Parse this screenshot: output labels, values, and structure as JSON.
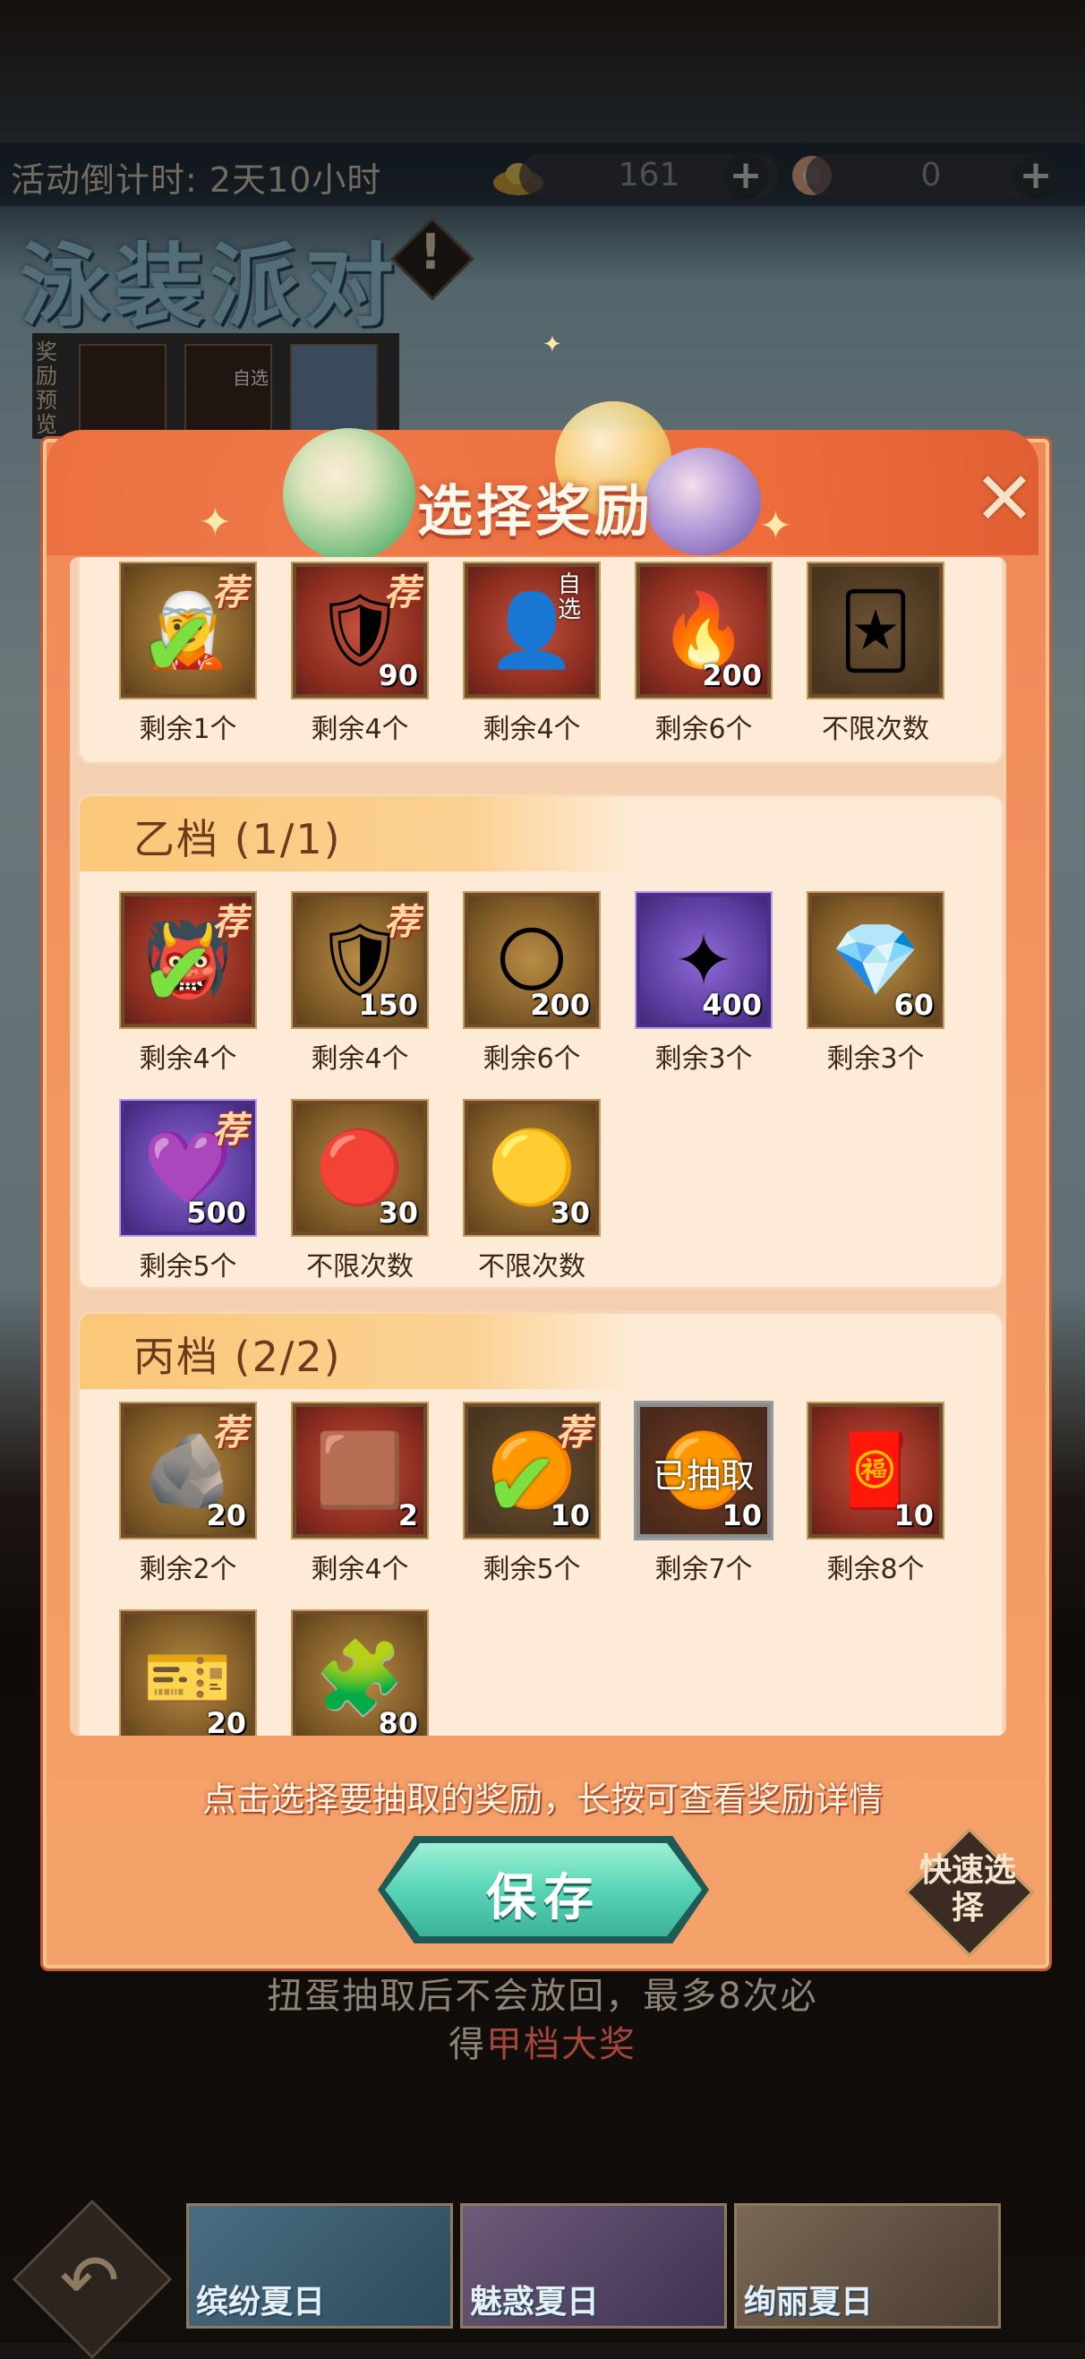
{
  "header": {
    "countdown": "活动倒计时: 2天10小时",
    "gold_amount": "161",
    "pearl_amount": "0",
    "plus_symbol": "+",
    "event_title": "泳装派对",
    "info_symbol": "!",
    "preview_label": "奖励预览",
    "preview_choose_tag": "自选"
  },
  "modal": {
    "title": "选择奖励",
    "close_symbol": "✕",
    "hint": "点击选择要抽取的奖励，长按可查看奖励详情",
    "save_label": "保存",
    "quick_label": "快速选择"
  },
  "tier_a": {
    "items": [
      {
        "icon": "character-card-icon",
        "glyph": "🧝",
        "style": "gold",
        "recommended": true,
        "checked": true,
        "quantity": "",
        "remaining": "剩余1个"
      },
      {
        "icon": "divine-banner-icon",
        "glyph": "🛡",
        "style": "red",
        "recommended": true,
        "checked": false,
        "quantity": "90",
        "remaining": "剩余4个"
      },
      {
        "icon": "silhouette-select-icon",
        "glyph": "👤",
        "style": "red",
        "recommended": false,
        "checked": false,
        "quantity": "",
        "choose": "自选",
        "remaining": "剩余4个"
      },
      {
        "icon": "fire-orb-icon",
        "glyph": "🔥",
        "style": "red",
        "recommended": false,
        "checked": false,
        "quantity": "200",
        "remaining": "剩余6个"
      },
      {
        "icon": "spirit-card-icon",
        "glyph": "🃏",
        "style": "dark",
        "recommended": false,
        "checked": false,
        "quantity": "",
        "remaining": "不限次数"
      }
    ]
  },
  "tier_b": {
    "title": "乙档 (1/1)",
    "items": [
      {
        "icon": "armor-character-icon",
        "glyph": "👹",
        "style": "red",
        "recommended": true,
        "checked": true,
        "quantity": "",
        "remaining": "剩余4个"
      },
      {
        "icon": "divine-banner-gold-icon",
        "glyph": "🛡",
        "style": "gold",
        "recommended": true,
        "checked": false,
        "quantity": "150",
        "remaining": "剩余4个"
      },
      {
        "icon": "gold-coin-stone-icon",
        "glyph": "🌕",
        "style": "gold",
        "recommended": false,
        "checked": false,
        "quantity": "200",
        "remaining": "剩余6个"
      },
      {
        "icon": "purple-star-icon",
        "glyph": "✦",
        "style": "purple",
        "recommended": false,
        "checked": false,
        "quantity": "400",
        "remaining": "剩余3个"
      },
      {
        "icon": "soul-crystal-icon",
        "glyph": "💎",
        "style": "gold",
        "recommended": false,
        "checked": false,
        "quantity": "60",
        "remaining": "剩余3个"
      },
      {
        "icon": "purple-gem-icon",
        "glyph": "💜",
        "style": "purple",
        "recommended": true,
        "checked": false,
        "quantity": "500",
        "remaining": "剩余5个"
      },
      {
        "icon": "red-swirl-stone-icon",
        "glyph": "🔴",
        "style": "gold",
        "recommended": false,
        "checked": false,
        "quantity": "30",
        "remaining": "不限次数"
      },
      {
        "icon": "cloud-coin-icon",
        "glyph": "🟡",
        "style": "gold",
        "recommended": false,
        "checked": false,
        "quantity": "30",
        "remaining": "不限次数"
      }
    ]
  },
  "tier_c": {
    "title": "丙档 (2/2)",
    "taken_label": "已抽取",
    "items": [
      {
        "icon": "blue-ore-icon",
        "glyph": "🪨",
        "style": "gold",
        "recommended": true,
        "checked": false,
        "taken": false,
        "quantity": "20",
        "remaining": "剩余2个"
      },
      {
        "icon": "copper-ore-icon",
        "glyph": "🟫",
        "style": "red",
        "recommended": false,
        "checked": false,
        "taken": false,
        "quantity": "2",
        "remaining": "剩余4个"
      },
      {
        "icon": "amber-orb-icon",
        "glyph": "🟠",
        "style": "dark",
        "recommended": true,
        "checked": true,
        "taken": false,
        "quantity": "10",
        "remaining": "剩余5个"
      },
      {
        "icon": "amber-orb-taken-icon",
        "glyph": "🟠",
        "style": "taken",
        "recommended": false,
        "checked": false,
        "taken": true,
        "quantity": "10",
        "remaining": "剩余7个"
      },
      {
        "icon": "red-envelope-icon",
        "glyph": "🧧",
        "style": "red",
        "recommended": false,
        "checked": false,
        "taken": false,
        "quantity": "10",
        "remaining": "剩余8个"
      },
      {
        "icon": "gold-ticket-icon",
        "glyph": "🎫",
        "style": "gold",
        "recommended": false,
        "checked": false,
        "taken": false,
        "quantity": "20",
        "remaining": ""
      },
      {
        "icon": "puzzle-piece-icon",
        "glyph": "🧩",
        "style": "gold",
        "recommended": false,
        "checked": false,
        "taken": false,
        "quantity": "80",
        "remaining": ""
      }
    ]
  },
  "badges": {
    "recommend": "荐"
  },
  "footer": {
    "line1": "扭蛋抽取后不会放回，最多8次必",
    "line2_prefix": "得",
    "line2_highlight": "甲档大奖",
    "tabs": [
      "缤纷夏日",
      "魅惑夏日",
      "绚丽夏日"
    ]
  }
}
